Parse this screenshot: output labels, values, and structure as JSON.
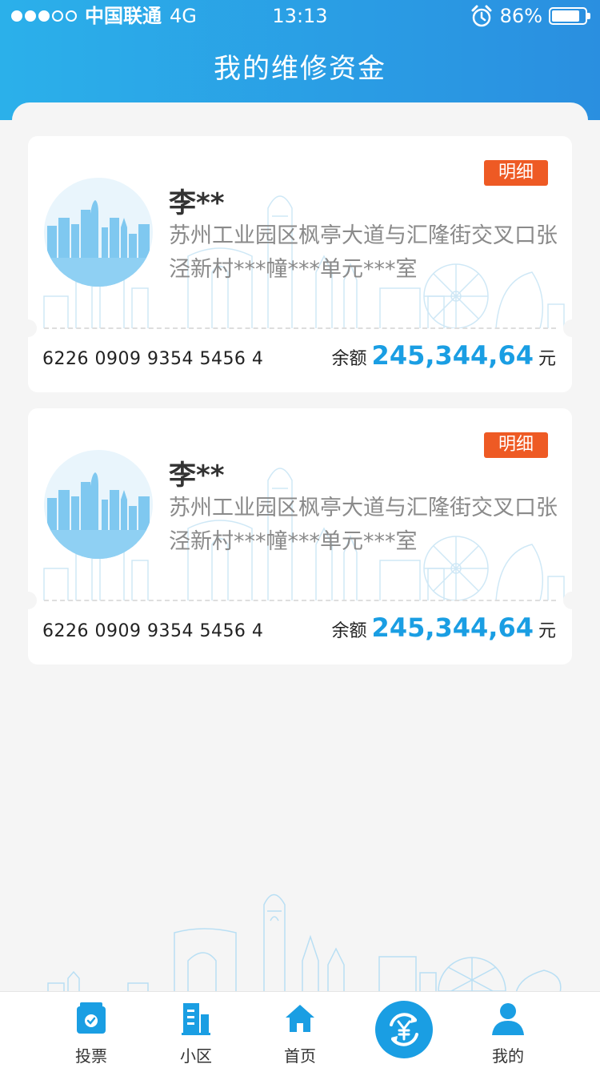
{
  "status_bar": {
    "carrier": "中国联通",
    "network": "4G",
    "time": "13:13",
    "battery": "86%",
    "battery_level": 0.86
  },
  "header": {
    "title": "我的维修资金"
  },
  "accounts": [
    {
      "name": "李**",
      "address": "苏州工业园区枫亭大道与汇隆街交叉口张泾新村***幢***单元***室",
      "detail_label": "明细",
      "card_number": "6226 0909 9354 5456 4",
      "balance_label": "余额",
      "balance_amount": "245,344,64",
      "balance_unit": "元"
    },
    {
      "name": "李**",
      "address": "苏州工业园区枫亭大道与汇隆街交叉口张泾新村***幢***单元***室",
      "detail_label": "明细",
      "card_number": "6226 0909 9354 5456 4",
      "balance_label": "余额",
      "balance_amount": "245,344,64",
      "balance_unit": "元"
    }
  ],
  "tab_bar": {
    "items": [
      {
        "label": "投票",
        "icon": "vote-icon"
      },
      {
        "label": "小区",
        "icon": "building-icon"
      },
      {
        "label": "首页",
        "icon": "home-icon"
      },
      {
        "label": "",
        "icon": "yuan-exchange-icon"
      },
      {
        "label": "我的",
        "icon": "user-icon"
      }
    ]
  },
  "colors": {
    "header_start": "#2bb0ea",
    "header_end": "#2a8fe0",
    "accent": "#1a9ee3",
    "detail_button": "#ee5a24"
  }
}
